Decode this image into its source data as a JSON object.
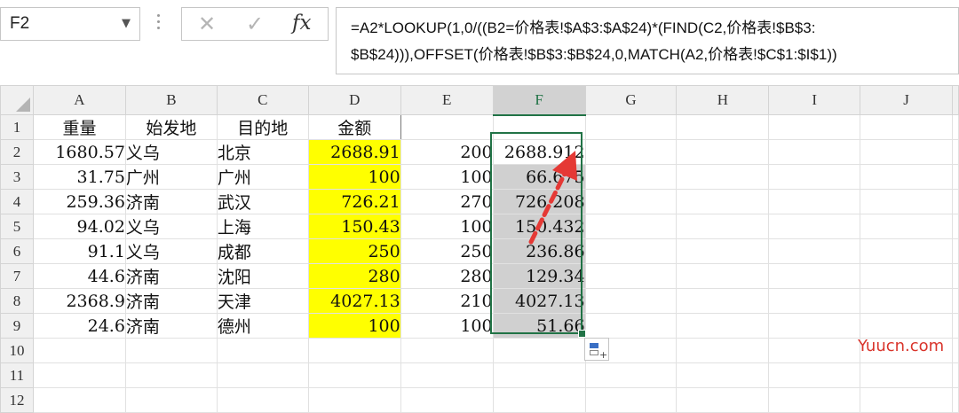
{
  "formula_bar": {
    "name_box": "F2",
    "cancel_icon": "✕",
    "enter_icon": "✓",
    "fx_label": "fx",
    "formula_line1": "=A2*LOOKUP(1,0/((B2=价格表!$A$3:$A$24)*(FIND(C2,价格表!$B$3:",
    "formula_line2": "$B$24))),OFFSET(价格表!$B$3:$B$24,0,MATCH(A2,价格表!$C$1:$I$1))"
  },
  "sheet": {
    "columns": [
      "A",
      "B",
      "C",
      "D",
      "E",
      "F",
      "G",
      "H",
      "I",
      "J"
    ],
    "row_numbers": [
      "1",
      "2",
      "3",
      "4",
      "5",
      "6",
      "7",
      "8",
      "9",
      "10",
      "11",
      "12"
    ],
    "header_row": {
      "A": "重量",
      "B": "始发地",
      "C": "目的地",
      "D": "金额"
    },
    "rows": [
      {
        "A": "1680.57",
        "B": "义乌",
        "C": "北京",
        "D": "2688.91",
        "E": "200",
        "F": "2688.912"
      },
      {
        "A": "31.75",
        "B": "广州",
        "C": "广州",
        "D": "100",
        "E": "100",
        "F": "66.675"
      },
      {
        "A": "259.36",
        "B": "济南",
        "C": "武汉",
        "D": "726.21",
        "E": "270",
        "F": "726.208"
      },
      {
        "A": "94.02",
        "B": "义乌",
        "C": "上海",
        "D": "150.43",
        "E": "100",
        "F": "150.432"
      },
      {
        "A": "91.1",
        "B": "义乌",
        "C": "成都",
        "D": "250",
        "E": "250",
        "F": "236.86"
      },
      {
        "A": "44.6",
        "B": "济南",
        "C": "沈阳",
        "D": "280",
        "E": "280",
        "F": "129.34"
      },
      {
        "A": "2368.9",
        "B": "济南",
        "C": "天津",
        "D": "4027.13",
        "E": "210",
        "F": "4027.13"
      },
      {
        "A": "24.6",
        "B": "济南",
        "C": "德州",
        "D": "100",
        "E": "100",
        "F": "51.66"
      }
    ],
    "active_cell": "F2"
  },
  "colors": {
    "highlight_yellow": "#ffff00",
    "selection_grey": "#d0d0d0",
    "excel_green": "#217346",
    "arrow_red": "#e53935"
  },
  "watermark": "Yuucn.com"
}
